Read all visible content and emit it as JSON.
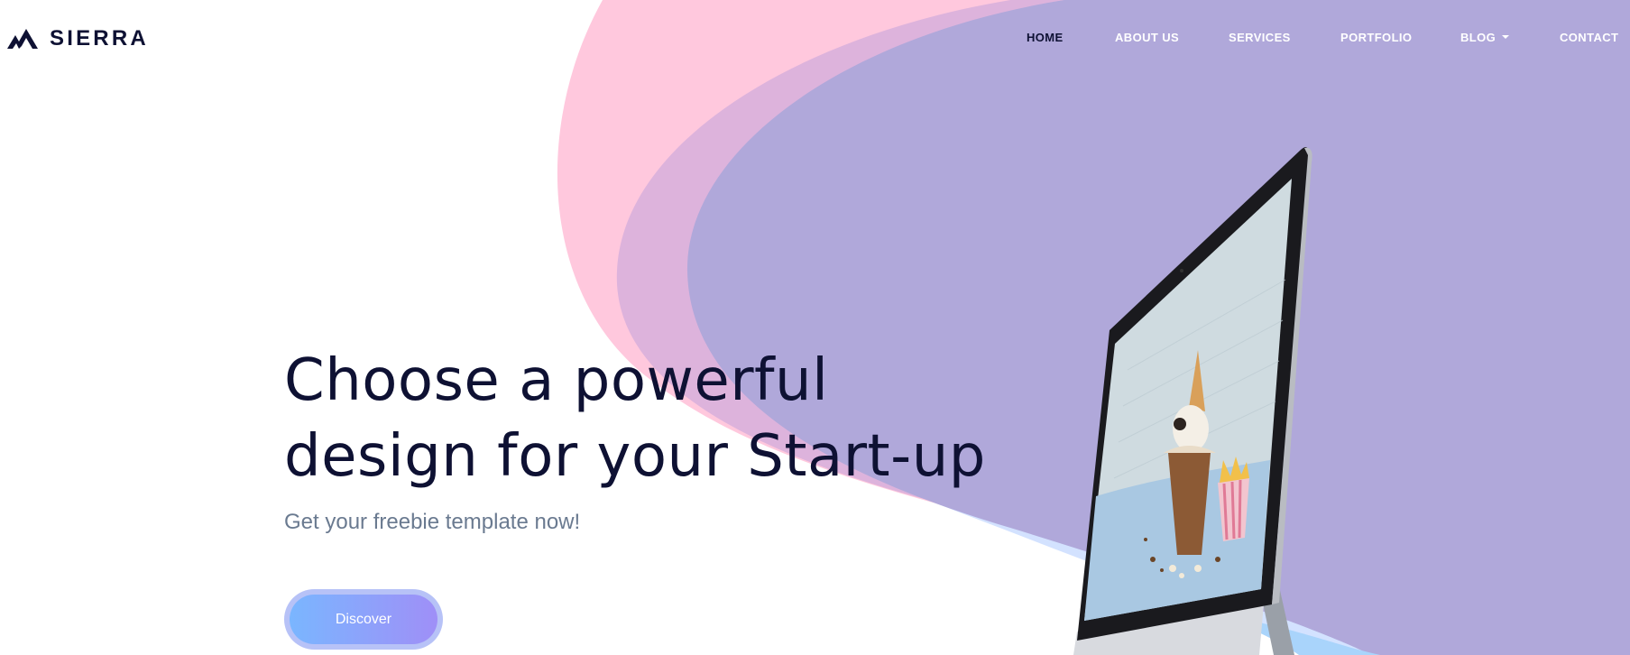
{
  "brand": {
    "name": "SIERRA",
    "logo_icon": "mountain-logo-icon"
  },
  "nav": {
    "items": [
      {
        "label": "HOME",
        "active": true
      },
      {
        "label": "ABOUT US",
        "active": false
      },
      {
        "label": "SERVICES",
        "active": false
      },
      {
        "label": "PORTFOLIO",
        "active": false
      },
      {
        "label": "BLOG",
        "active": false,
        "has_dropdown": true
      },
      {
        "label": "CONTACT",
        "active": false
      }
    ]
  },
  "hero": {
    "title_line1": "Choose a powerful",
    "title_line2": "design for your Start-up",
    "subtitle": "Get your freebie template now!",
    "cta_label": "Discover"
  },
  "colors": {
    "text_dark": "#0e1133",
    "subtitle_gray": "#6a7a90",
    "pink_wave": "#ffc8dd",
    "mauve_wave": "#ddb3dc",
    "purple_bg": "#b0a8da",
    "light_blue_wave": "#d3e2ff",
    "button_gradient_start": "#7ab6ff",
    "button_gradient_end": "#9f8ff7"
  }
}
